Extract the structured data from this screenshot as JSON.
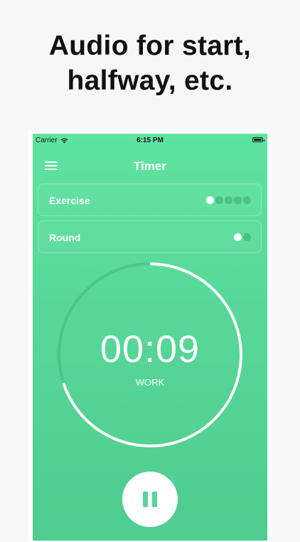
{
  "headline": {
    "line1": "Audio for start,",
    "line2": "halfway, etc."
  },
  "status_bar": {
    "carrier": "Carrier",
    "wifi_icon": "wifi-icon",
    "time": "6:15 PM",
    "battery_icon": "battery-icon"
  },
  "nav": {
    "menu_icon": "hamburger-menu-icon",
    "title": "Timer"
  },
  "exercise": {
    "label": "Exercise",
    "total": 5,
    "current": 1
  },
  "round": {
    "label": "Round",
    "total": 2,
    "current": 1
  },
  "timer": {
    "value": "00:09",
    "phase": "WORK",
    "progress": 0.3
  },
  "controls": {
    "pause_icon": "pause-icon"
  },
  "colors": {
    "background": "#f7f7f7",
    "accent_green": "#55d596",
    "white": "#ffffff",
    "dot_inactive": "#3caa6e"
  }
}
